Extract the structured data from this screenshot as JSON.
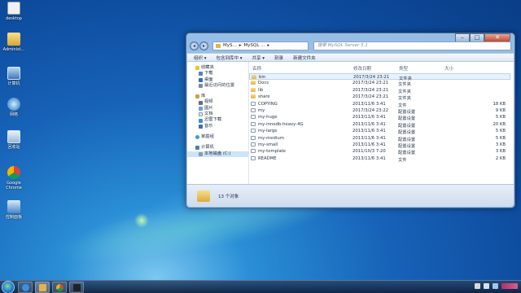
{
  "desktop": {
    "icons": [
      {
        "label": "desktop"
      },
      {
        "label": "Administ..."
      },
      {
        "label": "计算机"
      },
      {
        "label": "网络"
      },
      {
        "label": "回收站"
      },
      {
        "label": "Google Chrome"
      },
      {
        "label": "控制面板"
      }
    ]
  },
  "window": {
    "address": {
      "crumb1": "MyS...",
      "crumb2": "MySQL ...",
      "sep": "▸"
    },
    "search": {
      "placeholder": "搜索 MySQL Server 5.1"
    },
    "controls": {
      "min": "–",
      "max": "□",
      "close": "✕"
    },
    "nav": {
      "back": "◂",
      "forward": "▸"
    },
    "toolbar": {
      "organize": "组织 ▾",
      "include": "包含到库中 ▾",
      "share": "共享 ▾",
      "burn": "刻录",
      "new_folder": "新建文件夹"
    },
    "sidebar": {
      "favorites": [
        {
          "label": "收藏夹"
        },
        {
          "label": "下载"
        },
        {
          "label": "桌面"
        },
        {
          "label": "最近访问的位置"
        }
      ],
      "libraries": [
        {
          "label": "库"
        },
        {
          "label": "视频"
        },
        {
          "label": "图片"
        },
        {
          "label": "文档"
        },
        {
          "label": "迅雷下载"
        },
        {
          "label": "音乐"
        }
      ],
      "homegroup": {
        "label": "家庭组"
      },
      "computer": [
        {
          "label": "计算机"
        },
        {
          "label": "本地磁盘 (C:)"
        }
      ]
    },
    "columns": {
      "name": "名称",
      "modified": "修改日期",
      "type": "类型",
      "size": "大小"
    },
    "files": [
      {
        "name": "bin",
        "modified": "2017/3/24 23:21",
        "type": "文件夹",
        "size": ""
      },
      {
        "name": "Docs",
        "modified": "2017/3/24 23:21",
        "type": "文件夹",
        "size": ""
      },
      {
        "name": "lib",
        "modified": "2017/3/24 23:21",
        "type": "文件夹",
        "size": ""
      },
      {
        "name": "share",
        "modified": "2017/3/24 23:21",
        "type": "文件夹",
        "size": ""
      },
      {
        "name": "COPYING",
        "modified": "2013/11/6 3:41",
        "type": "文件",
        "size": "18 KB"
      },
      {
        "name": "my",
        "modified": "2017/3/24 23:22",
        "type": "配置设置",
        "size": "9 KB"
      },
      {
        "name": "my-huge",
        "modified": "2013/11/6 3:41",
        "type": "配置设置",
        "size": "5 KB"
      },
      {
        "name": "my-innodb-heavy-4G",
        "modified": "2013/11/6 3:41",
        "type": "配置设置",
        "size": "20 KB"
      },
      {
        "name": "my-large",
        "modified": "2013/11/6 3:41",
        "type": "配置设置",
        "size": "5 KB"
      },
      {
        "name": "my-medium",
        "modified": "2013/11/6 3:41",
        "type": "配置设置",
        "size": "5 KB"
      },
      {
        "name": "my-small",
        "modified": "2013/11/6 3:41",
        "type": "配置设置",
        "size": "3 KB"
      },
      {
        "name": "my-template",
        "modified": "2011/10/3 7:20",
        "type": "配置设置",
        "size": "3 KB"
      },
      {
        "name": "README",
        "modified": "2013/11/6 3:41",
        "type": "文件",
        "size": "2 KB"
      }
    ],
    "status": {
      "count": "13 个对象"
    }
  },
  "colors": {
    "accent": "#1763b8",
    "selection": "#cde4f7",
    "folder": "#e1b44a"
  },
  "icons": {
    "sidebar": [
      "star-icon",
      "folder-icon",
      "monitor-icon",
      "library-icon",
      "homegroup-icon",
      "computer-icon",
      "drive-icon"
    ],
    "tray": [
      "flag-icon",
      "speaker-icon",
      "network-icon"
    ]
  }
}
